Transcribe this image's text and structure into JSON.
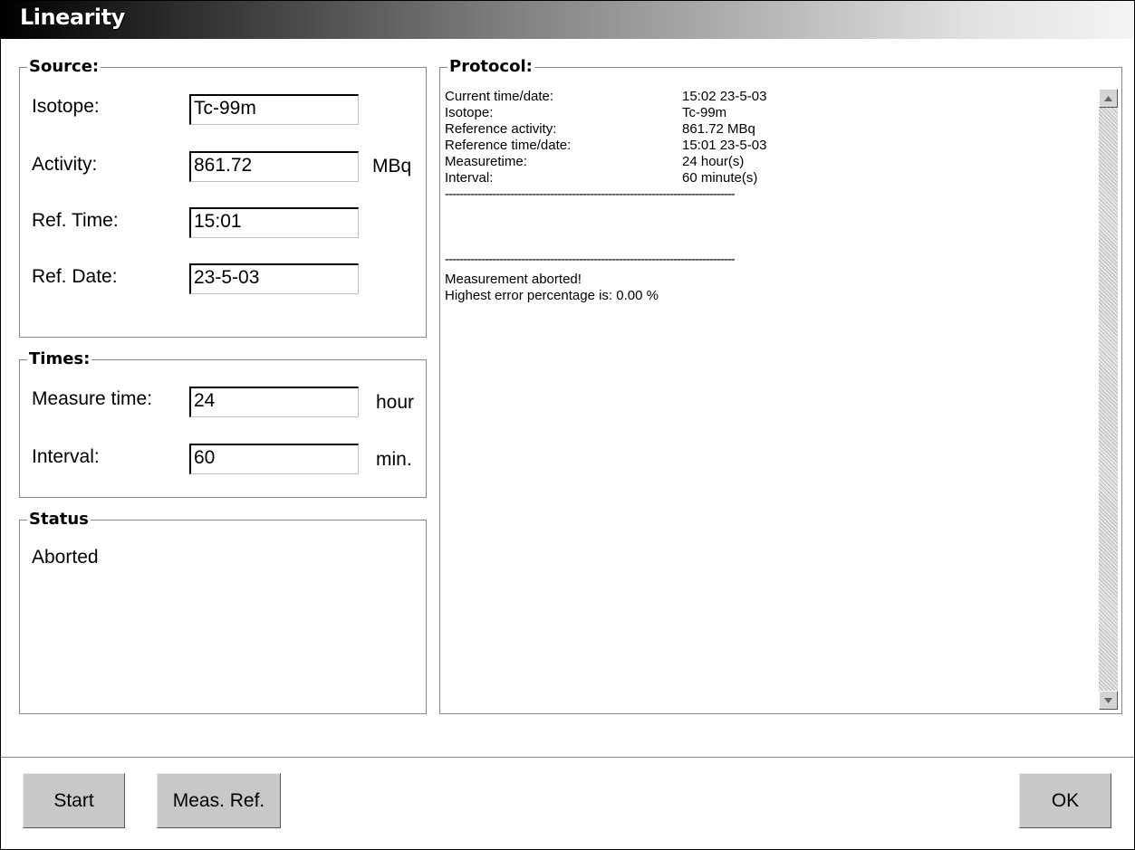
{
  "window": {
    "title": "Linearity"
  },
  "source": {
    "legend": "Source:",
    "isotope_label": "Isotope:",
    "isotope_value": "Tc-99m",
    "activity_label": "Activity:",
    "activity_value": "861.72",
    "activity_unit": "MBq",
    "reftime_label": "Ref. Time:",
    "reftime_value": "15:01",
    "refdate_label": "Ref. Date:",
    "refdate_value": "23-5-03"
  },
  "times": {
    "legend": "Times:",
    "measure_label": "Measure time:",
    "measure_value": "24",
    "measure_unit": "hour",
    "interval_label": "Interval:",
    "interval_value": "60",
    "interval_unit": "min."
  },
  "status": {
    "legend": "Status",
    "text": "Aborted"
  },
  "protocol": {
    "legend": "Protocol:",
    "rows": [
      {
        "key": "Current time/date:",
        "value": "15:02 23-5-03"
      },
      {
        "key": "Isotope:",
        "value": "Tc-99m"
      },
      {
        "key": "Reference activity:",
        "value": "861.72 MBq"
      },
      {
        "key": "Reference time/date:",
        "value": "15:01 23-5-03"
      },
      {
        "key": "Measuretime:",
        "value": "24 hour(s)"
      },
      {
        "key": "Interval:",
        "value": "60 minute(s)"
      }
    ],
    "separator": "--------------------------------------------------------------------------------",
    "message1": "Measurement aborted!",
    "message2": "Highest error percentage is: 0.00 %"
  },
  "scrollbar": {
    "up_icon": "arrow-up-icon",
    "down_icon": "arrow-down-icon"
  },
  "buttons": {
    "start": "Start",
    "meas_ref": "Meas. Ref.",
    "ok": "OK"
  }
}
